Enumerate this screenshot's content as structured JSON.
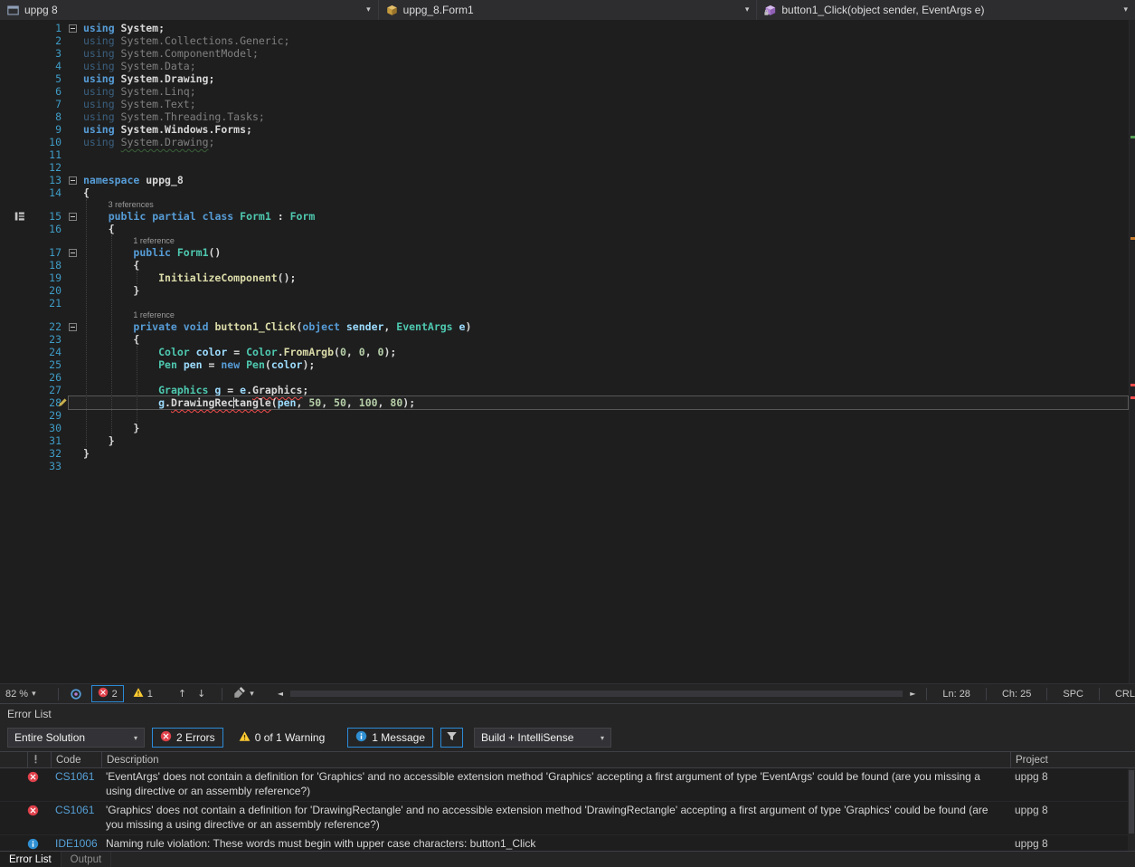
{
  "navbar": {
    "project_dropdown": "uppg 8",
    "type_dropdown": "uppg_8.Form1",
    "member_dropdown": "button1_Click(object sender, EventArgs e)"
  },
  "editor": {
    "lines": [
      {
        "n": 1,
        "fold": 1,
        "tk": [
          [
            "k",
            "using"
          ],
          [
            "d",
            " System;"
          ]
        ]
      },
      {
        "n": 2,
        "dim": 1,
        "tk": [
          [
            "k",
            "using"
          ],
          [
            "d",
            " System.Collections.Generic;"
          ]
        ]
      },
      {
        "n": 3,
        "dim": 1,
        "tk": [
          [
            "k",
            "using"
          ],
          [
            "d",
            " System.ComponentModel;"
          ]
        ]
      },
      {
        "n": 4,
        "dim": 1,
        "tk": [
          [
            "k",
            "using"
          ],
          [
            "d",
            " System.Data;"
          ]
        ]
      },
      {
        "n": 5,
        "tk": [
          [
            "k",
            "using"
          ],
          [
            "d",
            " System.Drawing;"
          ]
        ]
      },
      {
        "n": 6,
        "dim": 1,
        "tk": [
          [
            "k",
            "using"
          ],
          [
            "d",
            " System.Linq;"
          ]
        ]
      },
      {
        "n": 7,
        "dim": 1,
        "tk": [
          [
            "k",
            "using"
          ],
          [
            "d",
            " System.Text;"
          ]
        ]
      },
      {
        "n": 8,
        "dim": 1,
        "tk": [
          [
            "k",
            "using"
          ],
          [
            "d",
            " System.Threading.Tasks;"
          ]
        ]
      },
      {
        "n": 9,
        "tk": [
          [
            "k",
            "using"
          ],
          [
            "d",
            " System.Windows.Forms;"
          ]
        ]
      },
      {
        "n": 10,
        "dim": 1,
        "tk": [
          [
            "k",
            "using"
          ],
          [
            "d",
            " "
          ],
          [
            "d",
            "System.Drawing",
            "green"
          ],
          [
            "d",
            ";"
          ]
        ]
      },
      {
        "n": 11,
        "tk": []
      },
      {
        "n": 12,
        "tk": []
      },
      {
        "n": 13,
        "fold": 1,
        "tk": [
          [
            "k",
            "namespace"
          ],
          [
            "d",
            " uppg_8"
          ]
        ]
      },
      {
        "n": 14,
        "tk": [
          [
            "d",
            "{"
          ]
        ]
      },
      {
        "ref": "3 references",
        "indent": 4
      },
      {
        "n": 15,
        "fold": 1,
        "glyph": "inherit",
        "tk": [
          [
            "d",
            "    "
          ],
          [
            "k",
            "public"
          ],
          [
            "d",
            " "
          ],
          [
            "k",
            "partial"
          ],
          [
            "d",
            " "
          ],
          [
            "k",
            "class"
          ],
          [
            "d",
            " "
          ],
          [
            "t",
            "Form1"
          ],
          [
            "d",
            " : "
          ],
          [
            "t",
            "Form"
          ]
        ]
      },
      {
        "n": 16,
        "tk": [
          [
            "d",
            "    {"
          ]
        ]
      },
      {
        "ref": "1 reference",
        "indent": 8
      },
      {
        "n": 17,
        "fold": 1,
        "tk": [
          [
            "d",
            "        "
          ],
          [
            "k",
            "public"
          ],
          [
            "d",
            " "
          ],
          [
            "t",
            "Form1"
          ],
          [
            "d",
            "()"
          ]
        ]
      },
      {
        "n": 18,
        "tk": [
          [
            "d",
            "        {"
          ]
        ]
      },
      {
        "n": 19,
        "tk": [
          [
            "d",
            "            "
          ],
          [
            "m",
            "InitializeComponent"
          ],
          [
            "d",
            "();"
          ]
        ]
      },
      {
        "n": 20,
        "tk": [
          [
            "d",
            "        }"
          ]
        ]
      },
      {
        "n": 21,
        "tk": []
      },
      {
        "ref": "1 reference",
        "indent": 8
      },
      {
        "n": 22,
        "fold": 1,
        "tk": [
          [
            "d",
            "        "
          ],
          [
            "k",
            "private"
          ],
          [
            "d",
            " "
          ],
          [
            "k",
            "void"
          ],
          [
            "d",
            " "
          ],
          [
            "m",
            "button1_Click"
          ],
          [
            "d",
            "("
          ],
          [
            "k",
            "object"
          ],
          [
            "d",
            " "
          ],
          [
            "v",
            "sender"
          ],
          [
            "d",
            ", "
          ],
          [
            "t",
            "EventArgs"
          ],
          [
            "d",
            " "
          ],
          [
            "v",
            "e"
          ],
          [
            "d",
            ")"
          ]
        ]
      },
      {
        "n": 23,
        "tk": [
          [
            "d",
            "        {"
          ]
        ]
      },
      {
        "n": 24,
        "tk": [
          [
            "d",
            "            "
          ],
          [
            "t",
            "Color"
          ],
          [
            "d",
            " "
          ],
          [
            "v",
            "color"
          ],
          [
            "d",
            " = "
          ],
          [
            "t",
            "Color"
          ],
          [
            "d",
            "."
          ],
          [
            "m",
            "FromArgb"
          ],
          [
            "d",
            "("
          ],
          [
            "num",
            "0"
          ],
          [
            "d",
            ", "
          ],
          [
            "num",
            "0"
          ],
          [
            "d",
            ", "
          ],
          [
            "num",
            "0"
          ],
          [
            "d",
            ");"
          ]
        ]
      },
      {
        "n": 25,
        "tk": [
          [
            "d",
            "            "
          ],
          [
            "t",
            "Pen"
          ],
          [
            "d",
            " "
          ],
          [
            "v",
            "pen"
          ],
          [
            "d",
            " = "
          ],
          [
            "k",
            "new"
          ],
          [
            "d",
            " "
          ],
          [
            "t",
            "Pen"
          ],
          [
            "d",
            "("
          ],
          [
            "v",
            "color"
          ],
          [
            "d",
            ");"
          ]
        ]
      },
      {
        "n": 26,
        "tk": []
      },
      {
        "n": 27,
        "tk": [
          [
            "d",
            "            "
          ],
          [
            "t",
            "Graphics"
          ],
          [
            "d",
            " "
          ],
          [
            "v",
            "g"
          ],
          [
            "d",
            " = "
          ],
          [
            "v",
            "e"
          ],
          [
            "d",
            "."
          ],
          [
            "d",
            "Graphics",
            "red"
          ],
          [
            "d",
            ";"
          ]
        ]
      },
      {
        "n": 28,
        "current": 1,
        "glyph": "pencil",
        "caret": 24,
        "tk": [
          [
            "d",
            "            "
          ],
          [
            "v",
            "g"
          ],
          [
            "d",
            "."
          ],
          [
            "d",
            "DrawingRectangle",
            "red"
          ],
          [
            "d",
            "("
          ],
          [
            "v",
            "pen"
          ],
          [
            "d",
            ", "
          ],
          [
            "num",
            "50"
          ],
          [
            "d",
            ", "
          ],
          [
            "num",
            "50"
          ],
          [
            "d",
            ", "
          ],
          [
            "num",
            "100"
          ],
          [
            "d",
            ", "
          ],
          [
            "num",
            "80"
          ],
          [
            "d",
            ");"
          ]
        ]
      },
      {
        "n": 29,
        "tk": []
      },
      {
        "n": 30,
        "tk": [
          [
            "d",
            "        }"
          ]
        ]
      },
      {
        "n": 31,
        "tk": [
          [
            "d",
            "    }"
          ]
        ]
      },
      {
        "n": 32,
        "tk": [
          [
            "d",
            "}"
          ]
        ]
      },
      {
        "n": 33,
        "tk": []
      }
    ]
  },
  "status_strip": {
    "zoom": "82 %",
    "error_count": "2",
    "warning_count": "1",
    "line_indicator": "Ln: 28",
    "column_indicator": "Ch: 25",
    "space_indicator": "SPC",
    "eol_indicator": "CRL"
  },
  "error_list": {
    "title": "Error List",
    "scope_filter": "Entire Solution",
    "errors_filter": "2 Errors",
    "warnings_filter": "0 of 1 Warning",
    "messages_filter": "1 Message",
    "source_filter": "Build + IntelliSense",
    "columns": {
      "code": "Code",
      "description": "Description",
      "project": "Project"
    },
    "rows": [
      {
        "severity": "error",
        "code": "CS1061",
        "description": "'EventArgs' does not contain a definition for 'Graphics' and no accessible extension method 'Graphics' accepting a first argument of type 'EventArgs' could be found (are you missing a using directive or an assembly reference?)",
        "project": "uppg 8"
      },
      {
        "severity": "error",
        "code": "CS1061",
        "description": "'Graphics' does not contain a definition for 'DrawingRectangle' and no accessible extension method 'DrawingRectangle' accepting a first argument of type 'Graphics' could be found (are you missing a using directive or an assembly reference?)",
        "project": "uppg 8"
      },
      {
        "severity": "info",
        "code": "IDE1006",
        "description": "Naming rule violation: These words must begin with upper case characters: button1_Click",
        "project": "uppg 8"
      }
    ],
    "tabs": [
      "Error List",
      "Output"
    ]
  },
  "colors": {
    "accent": "#2B8BD7",
    "error": "#E0404A",
    "warning": "#FFCC33",
    "info": "#2F8FD2"
  }
}
